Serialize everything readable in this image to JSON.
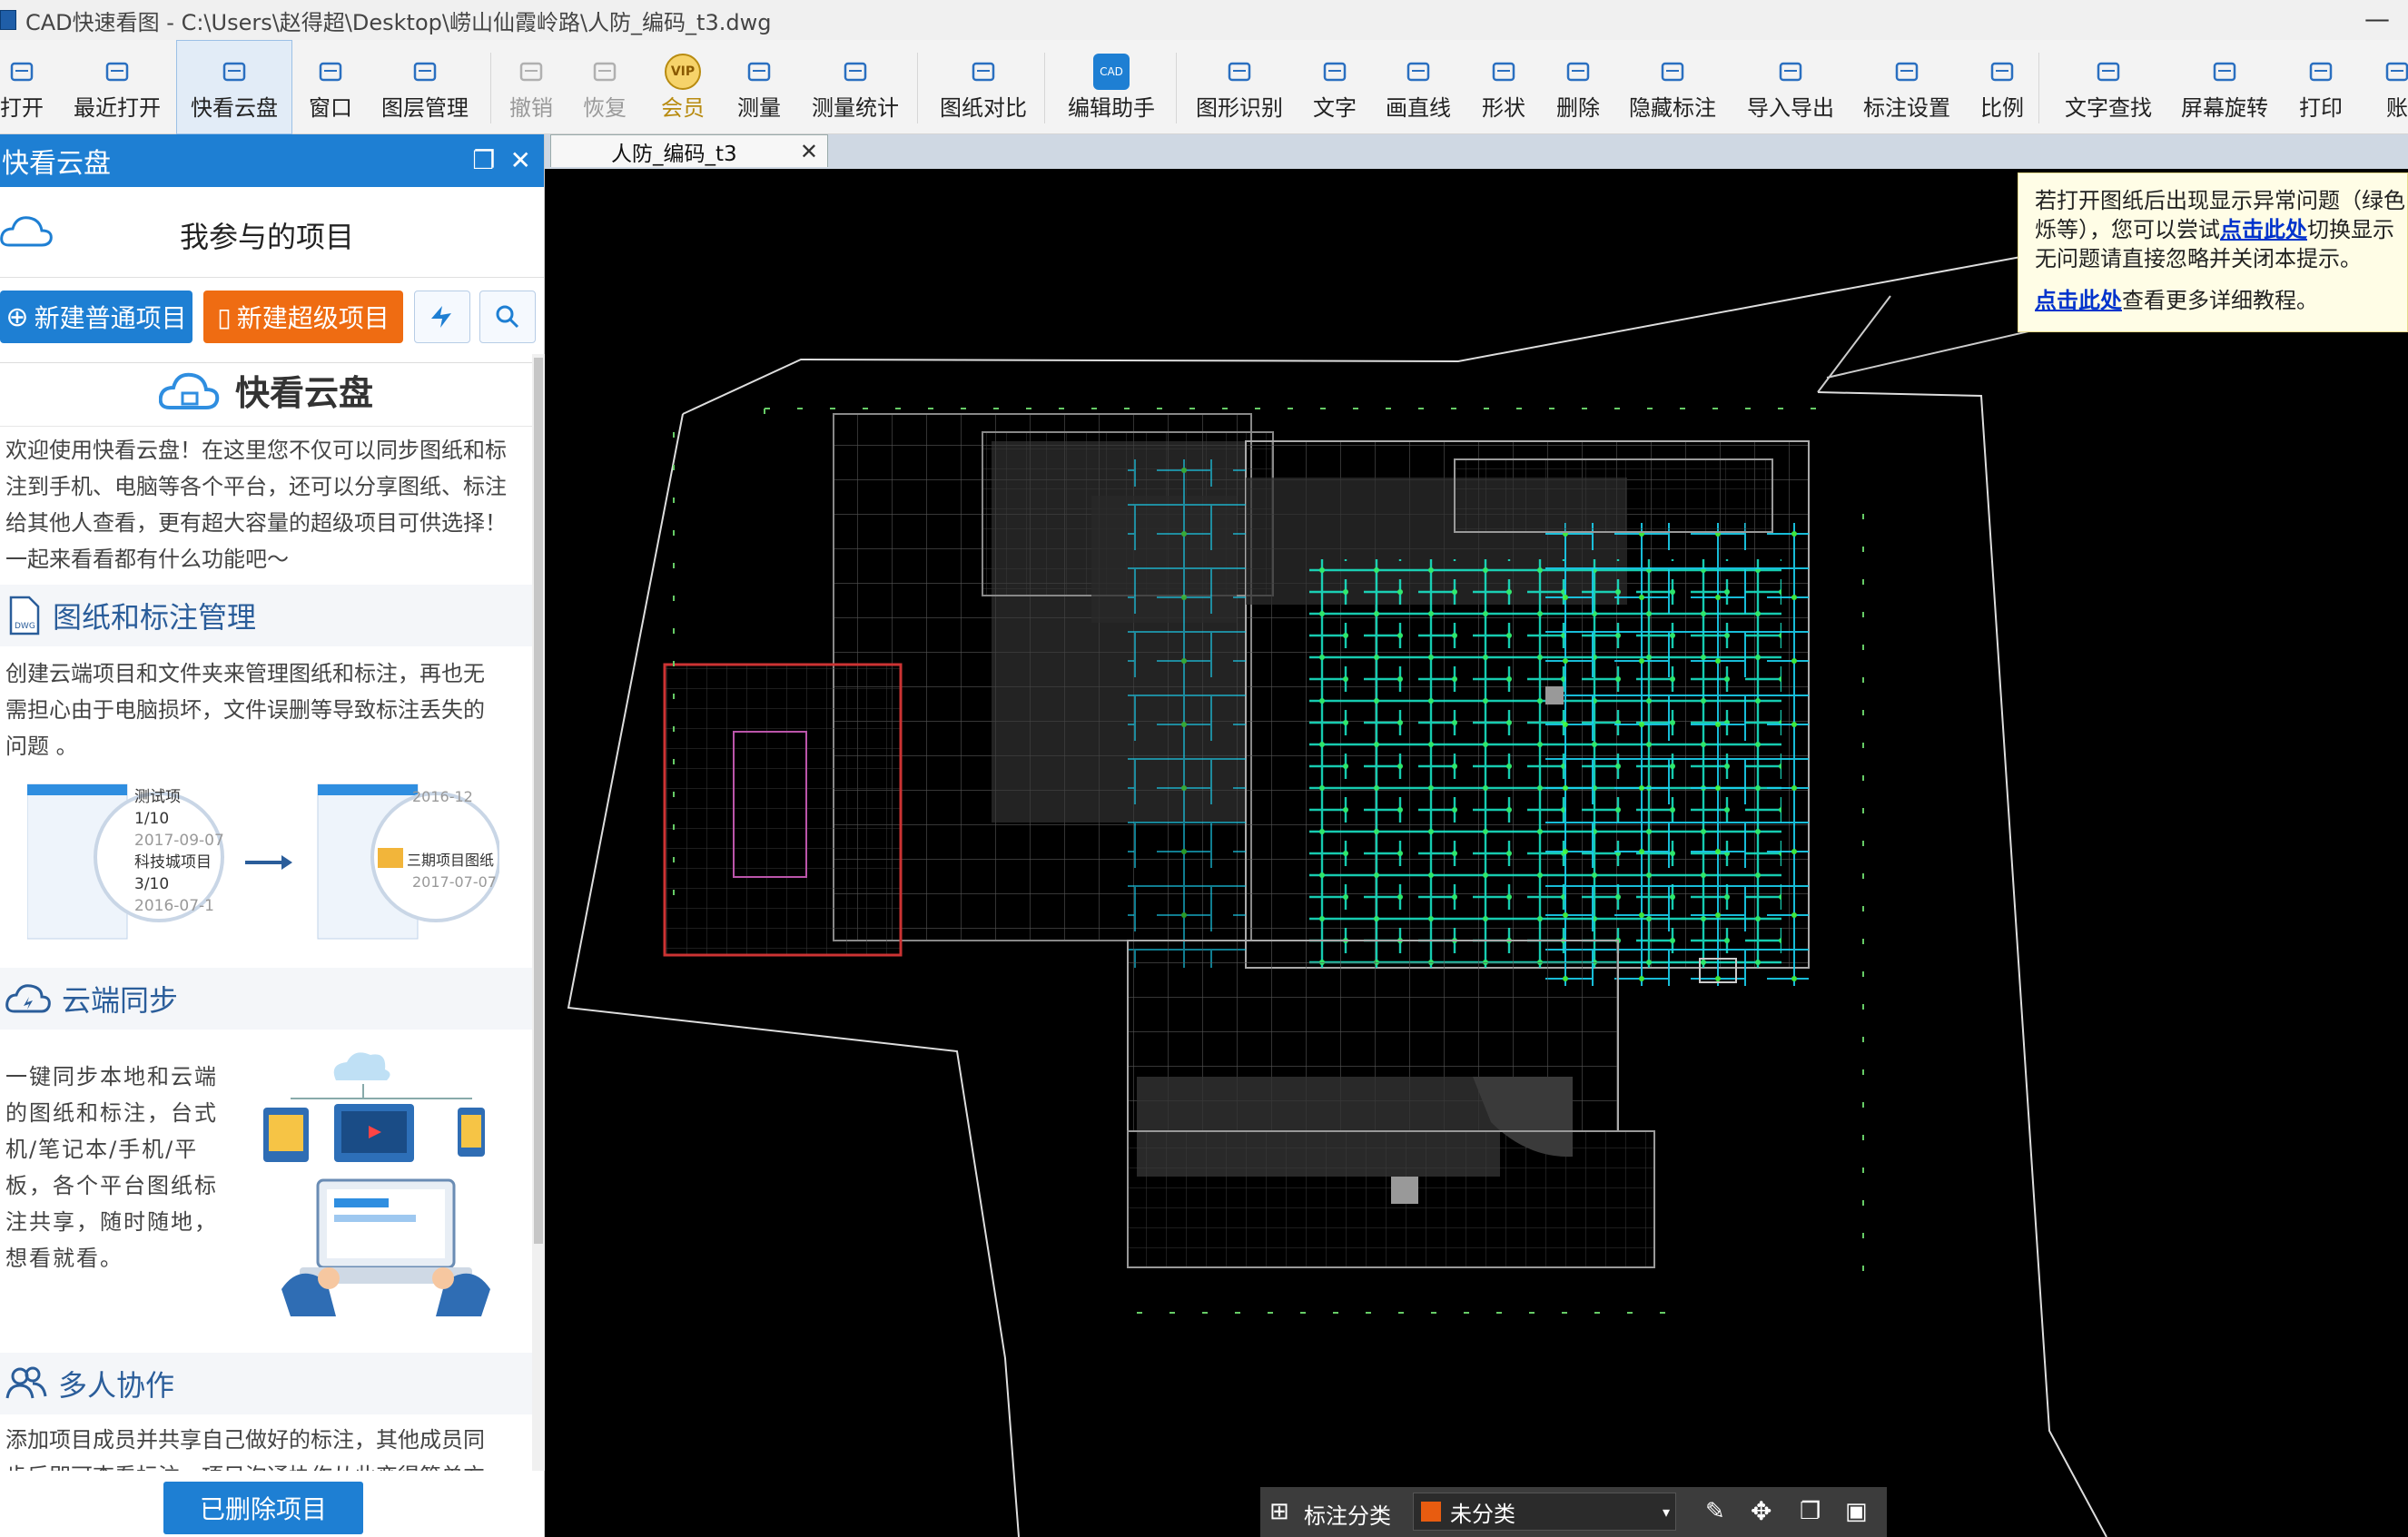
{
  "titlebar": {
    "title": "CAD快速看图 - C:\\Users\\赵得超\\Desktop\\崂山仙霞岭路\\人防_编码_t3.dwg"
  },
  "toolbar": {
    "items": [
      {
        "label": "打开",
        "icon": "folder-open-icon"
      },
      {
        "label": "最近打开",
        "icon": "history-icon"
      },
      {
        "label": "快看云盘",
        "icon": "cloud-icon"
      },
      {
        "label": "窗口",
        "icon": "window-icon"
      },
      {
        "label": "图层管理",
        "icon": "layers-icon"
      },
      {
        "label": "撤销",
        "icon": "undo-icon"
      },
      {
        "label": "恢复",
        "icon": "redo-icon"
      },
      {
        "label": "会员",
        "icon": "vip-icon"
      },
      {
        "label": "测量",
        "icon": "ruler-icon"
      },
      {
        "label": "测量统计",
        "icon": "measure-stats-icon"
      },
      {
        "label": "图纸对比",
        "icon": "compare-icon"
      },
      {
        "label": "编辑助手",
        "icon": "cad-edit-icon"
      },
      {
        "label": "图形识别",
        "icon": "shape-recognize-icon"
      },
      {
        "label": "文字",
        "icon": "text-icon"
      },
      {
        "label": "画直线",
        "icon": "line-icon"
      },
      {
        "label": "形状",
        "icon": "shapes-icon"
      },
      {
        "label": "删除",
        "icon": "eraser-icon"
      },
      {
        "label": "隐藏标注",
        "icon": "hide-eye-icon"
      },
      {
        "label": "导入导出",
        "icon": "import-export-icon"
      },
      {
        "label": "标注设置",
        "icon": "annotation-settings-icon"
      },
      {
        "label": "比例",
        "icon": "scale-icon"
      },
      {
        "label": "文字查找",
        "icon": "text-search-icon"
      },
      {
        "label": "屏幕旋转",
        "icon": "rotate-icon"
      },
      {
        "label": "打印",
        "icon": "print-icon"
      },
      {
        "label": "账",
        "icon": "account-icon"
      }
    ]
  },
  "panel": {
    "title": "快看云盘",
    "projects_heading": "我参与的项目",
    "new_normal": "新建普通项目",
    "new_super": "新建超级项目",
    "cloud_title": "快看云盘",
    "intro": [
      "欢迎使用快看云盘！在这里您不仅可以同步图纸和标",
      "注到手机、电脑等各个平台，还可以分享图纸、标注",
      "给其他人查看，更有超大容量的超级项目可供选择！",
      "一起来看看都有什么功能吧～"
    ],
    "sec1_title": "图纸和标注管理",
    "sec1_text": [
      "创建云端项目和文件夹来管理图纸和标注，再也无",
      "需担心由于电脑损坏，文件误删等导致标注丢失的",
      "问题 。"
    ],
    "illus": {
      "a1": "测试项",
      "a2": "1/10",
      "a3": "2017-09-07",
      "a4": "科技城项目",
      "a5": "3/10",
      "a6": "2016-07-1",
      "b1": "2016-12",
      "b2": "三期项目图纸",
      "b3": "2017-07-07"
    },
    "sec2_title": "云端同步",
    "sec2_text": [
      "一键同步本地和云端",
      "的图纸和标注，台式",
      "机/笔记本/手机/平",
      "板，各个平台图纸标",
      "注共享，随时随地，",
      "想看就看。"
    ],
    "sec3_title": "多人协作",
    "sec3_text": [
      "添加项目成员并共享自己做好的标注，其他成员同",
      "步后即可查看标注，项目沟通协作从此变得简单方"
    ],
    "deleted_btn": "已删除项目"
  },
  "tab": {
    "label": "人防_编码_t3"
  },
  "notice": {
    "line1": "若打开图纸后出现显示异常问题（绿色",
    "line2a": "烁等），您可以尝试",
    "link1": "点击此处",
    "line2b": "切换显示",
    "line3": "无问题请直接忽略并关闭本提示。",
    "link2": "点击此处",
    "line4": "查看更多详细教程。"
  },
  "statusbar": {
    "label": "标注分类",
    "category": "未分类"
  }
}
